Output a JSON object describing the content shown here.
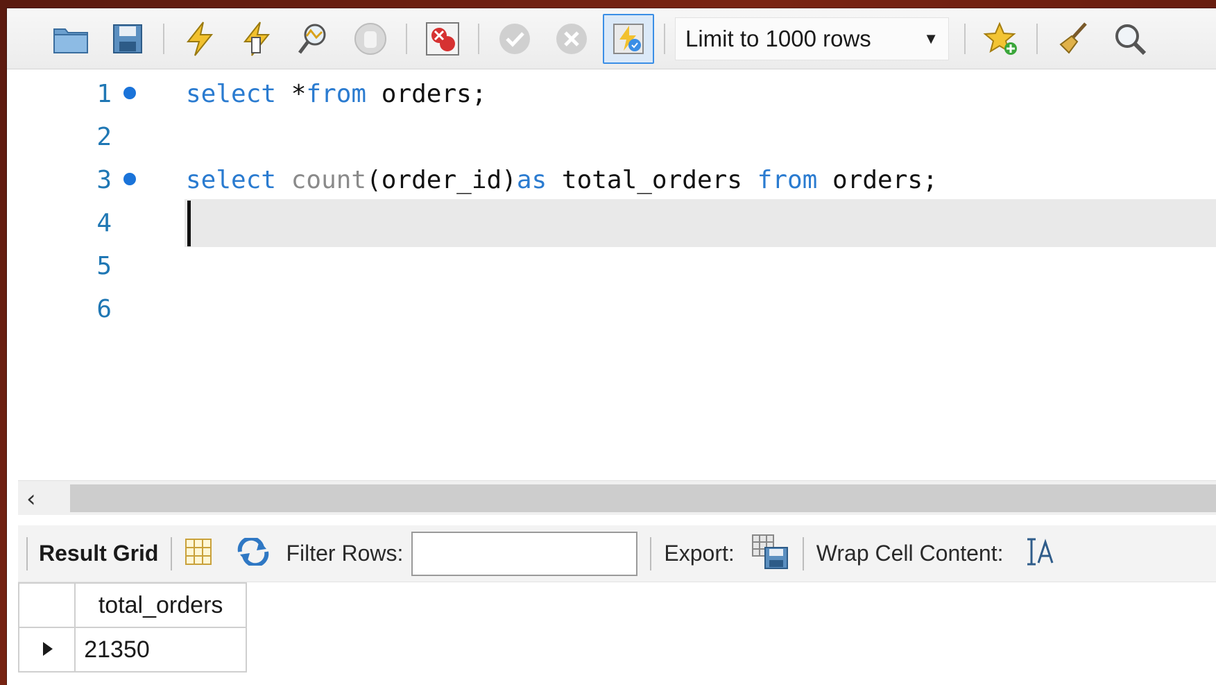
{
  "toolbar": {
    "buttons": [
      {
        "name": "open-folder-icon"
      },
      {
        "name": "save-icon"
      },
      {
        "name": "execute-icon"
      },
      {
        "name": "execute-current-icon"
      },
      {
        "name": "explain-icon"
      },
      {
        "name": "stop-icon"
      },
      {
        "name": "toggle-error-stop-icon"
      },
      {
        "name": "commit-icon"
      },
      {
        "name": "rollback-icon"
      },
      {
        "name": "autocommit-icon"
      }
    ],
    "limit_label": "Limit to 1000 rows",
    "right_buttons": [
      {
        "name": "add-snippet-icon"
      },
      {
        "name": "beautify-icon"
      },
      {
        "name": "find-icon"
      }
    ]
  },
  "editor": {
    "lines": [
      {
        "number": "1",
        "has_dot": true,
        "tokens": [
          {
            "t": "select",
            "c": "kw"
          },
          {
            "t": " *",
            "c": ""
          },
          {
            "t": "from",
            "c": "kw"
          },
          {
            "t": " orders;",
            "c": ""
          }
        ]
      },
      {
        "number": "2",
        "has_dot": false,
        "tokens": []
      },
      {
        "number": "3",
        "has_dot": true,
        "tokens": [
          {
            "t": "select",
            "c": "kw"
          },
          {
            "t": " ",
            "c": ""
          },
          {
            "t": "count",
            "c": "fn"
          },
          {
            "t": "(order_id)",
            "c": ""
          },
          {
            "t": "as",
            "c": "kw"
          },
          {
            "t": " total_orders ",
            "c": ""
          },
          {
            "t": "from",
            "c": "kw"
          },
          {
            "t": " orders;",
            "c": ""
          }
        ]
      },
      {
        "number": "4",
        "has_dot": false,
        "tokens": [],
        "current": true
      },
      {
        "number": "5",
        "has_dot": false,
        "tokens": []
      },
      {
        "number": "6",
        "has_dot": false,
        "tokens": []
      }
    ]
  },
  "result_bar": {
    "result_grid_label": "Result Grid",
    "filter_label": "Filter Rows:",
    "filter_value": "",
    "export_label": "Export:",
    "wrap_label": "Wrap Cell Content:"
  },
  "result_grid": {
    "columns": [
      "total_orders"
    ],
    "rows": [
      [
        "21350"
      ]
    ]
  },
  "colors": {
    "keyword": "#2a7bd0",
    "function": "#8a8a8a",
    "line_number": "#1f77b4"
  }
}
